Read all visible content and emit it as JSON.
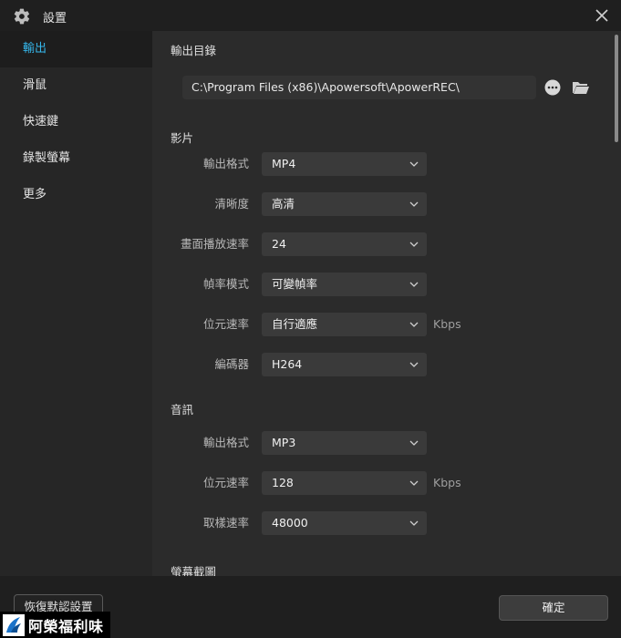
{
  "window": {
    "title": "設置",
    "icon": "gear-icon",
    "close_icon": "close-icon"
  },
  "sidebar": {
    "items": [
      {
        "label": "輸出",
        "active": true
      },
      {
        "label": "滑鼠",
        "active": false
      },
      {
        "label": "快速鍵",
        "active": false
      },
      {
        "label": "錄製螢幕",
        "active": false
      },
      {
        "label": "更多",
        "active": false
      }
    ]
  },
  "output": {
    "dir_title": "輸出目錄",
    "dir_path": "C:\\Program Files (x86)\\Apowersoft\\ApowerREC\\",
    "video": {
      "title": "影片",
      "rows": [
        {
          "label": "輸出格式",
          "value": "MP4",
          "unit": ""
        },
        {
          "label": "清晰度",
          "value": "高清",
          "unit": ""
        },
        {
          "label": "畫面播放速率",
          "value": "24",
          "unit": ""
        },
        {
          "label": "幀率模式",
          "value": "可變幀率",
          "unit": ""
        },
        {
          "label": "位元速率",
          "value": "自行適應",
          "unit": "Kbps"
        },
        {
          "label": "編碼器",
          "value": "H264",
          "unit": ""
        }
      ]
    },
    "audio": {
      "title": "音訊",
      "rows": [
        {
          "label": "輸出格式",
          "value": "MP3",
          "unit": ""
        },
        {
          "label": "位元速率",
          "value": "128",
          "unit": "Kbps"
        },
        {
          "label": "取樣速率",
          "value": "48000",
          "unit": ""
        }
      ]
    },
    "screenshot_title": "螢幕截圖"
  },
  "footer": {
    "reset_label": "恢復默認設置",
    "ok_label": "確定"
  },
  "watermark": {
    "text": "阿榮福利味"
  },
  "colors": {
    "accent": "#35b6ea",
    "background": "#2b2b2b",
    "sidebar": "#262626"
  }
}
